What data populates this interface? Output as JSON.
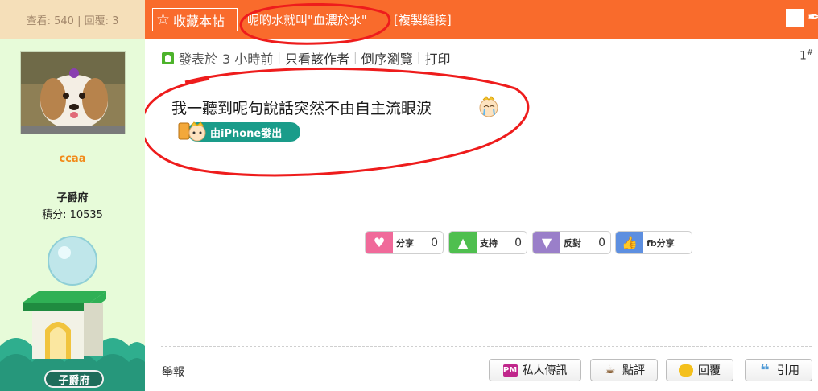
{
  "header": {
    "stats": "查看: 540 | 回覆: 3",
    "favorite_label": "收藏本帖",
    "thread_title": "呢啲水就叫\"血濃於水\"",
    "copy_link_label": "[複製鏈接]",
    "accent_color": "#f96b2c"
  },
  "author": {
    "username": "ccaa",
    "rank": "子爵府",
    "points": "積分: 10535",
    "rank_badge_label": "子爵府"
  },
  "post": {
    "posted_label": "發表於",
    "posted_time": "3 小時前",
    "only_author": "只看該作者",
    "reverse_browse": "倒序瀏覽",
    "print": "打印",
    "floor_number": "1",
    "floor_suffix": "#",
    "content": "我一聽到呢句說話突然不由自主流眼淚",
    "iphone_badge": "由iPhone發出"
  },
  "reactions": [
    {
      "label": "分享",
      "count": "0",
      "icon": "heart-icon",
      "color": "#f06a9a"
    },
    {
      "label": "支持",
      "count": "0",
      "icon": "arrow-up-icon",
      "color": "#4fbf4f"
    },
    {
      "label": "反對",
      "count": "0",
      "icon": "arrow-down-icon",
      "color": "#9a7fc9"
    },
    {
      "label": "fb分享",
      "count": "",
      "icon": "thumbs-up-icon",
      "color": "#5d8fe0"
    }
  ],
  "footer": {
    "report": "舉報",
    "buttons": [
      {
        "label": "私人傳訊",
        "icon": "pm-icon"
      },
      {
        "label": "點評",
        "icon": "coffee-icon"
      },
      {
        "label": "回覆",
        "icon": "speech-bubble-icon"
      },
      {
        "label": "引用",
        "icon": "quote-icon"
      }
    ]
  }
}
